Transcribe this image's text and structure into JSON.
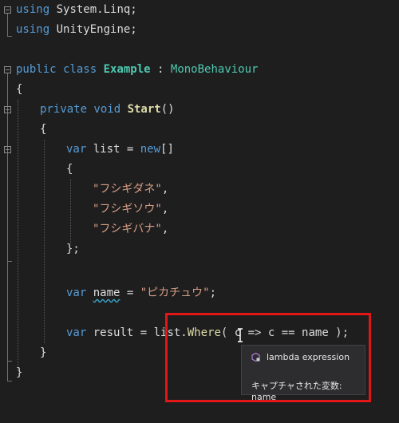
{
  "code": {
    "line1": {
      "kw": "using",
      "rest": " System.Linq;"
    },
    "line2": {
      "kw": "using",
      "rest": " UnityEngine;"
    },
    "line4": {
      "kw": "public class ",
      "cls": "Example",
      "sep": " : ",
      "base": "MonoBehaviour"
    },
    "line5": "{",
    "line6": {
      "kw": "private void ",
      "method": "Start",
      "rest": "()"
    },
    "line7": "{",
    "line8": {
      "kw": "var",
      "mid": " list = ",
      "kw2": "new",
      "rest": "[]"
    },
    "line9": "{",
    "line10": {
      "str": "\"フシギダネ\"",
      "rest": ","
    },
    "line11": {
      "str": "\"フシギソウ\"",
      "rest": ","
    },
    "line12": {
      "str": "\"フシギバナ\"",
      "rest": ","
    },
    "line13": "};",
    "line15": {
      "kw": "var",
      "sp": " ",
      "name": "name",
      "mid": " = ",
      "str": "\"ピカチュウ\"",
      "rest": ";"
    },
    "line17": {
      "kw": "var",
      "mid": " result = list.",
      "method": "Where",
      "rest_a": "( c ",
      "arrow": "=>",
      "rest_b": " c == name );"
    },
    "line18": "}",
    "line19": "}"
  },
  "tooltip": {
    "icon": "lambda-local-icon",
    "title": "lambda expression",
    "description": "キャプチャされた変数: name"
  },
  "colors": {
    "background": "#1e1e1e",
    "keyword": "#569cd6",
    "type": "#4ec9b0",
    "method": "#dcdcaa",
    "string": "#d69d85",
    "highlight": "#e21616"
  }
}
